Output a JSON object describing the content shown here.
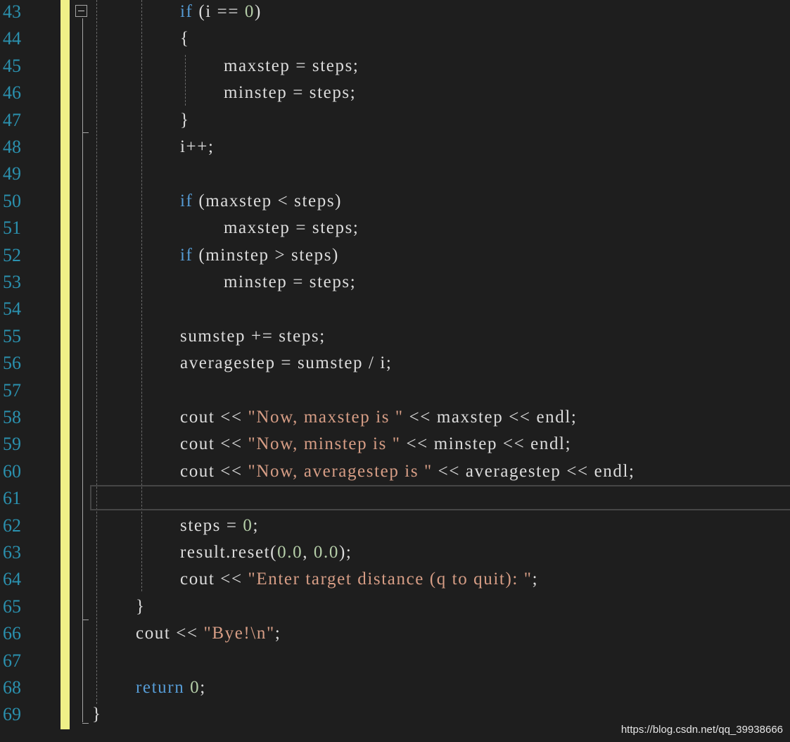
{
  "editor": {
    "lines": [
      {
        "num": "43",
        "indent": 4,
        "tokens": [
          {
            "t": "if",
            "c": "kw"
          },
          {
            "t": " (i == ",
            "c": "pl"
          },
          {
            "t": "0",
            "c": "num"
          },
          {
            "t": ")",
            "c": "pl"
          }
        ]
      },
      {
        "num": "44",
        "indent": 4,
        "tokens": [
          {
            "t": "{",
            "c": "pl"
          }
        ]
      },
      {
        "num": "45",
        "indent": 5,
        "tokens": [
          {
            "t": "maxstep = steps;",
            "c": "pl"
          }
        ]
      },
      {
        "num": "46",
        "indent": 5,
        "tokens": [
          {
            "t": "minstep = steps;",
            "c": "pl"
          }
        ]
      },
      {
        "num": "47",
        "indent": 4,
        "tokens": [
          {
            "t": "}",
            "c": "pl"
          }
        ]
      },
      {
        "num": "48",
        "indent": 4,
        "tokens": [
          {
            "t": "i++;",
            "c": "pl"
          }
        ]
      },
      {
        "num": "49",
        "indent": 4,
        "tokens": []
      },
      {
        "num": "50",
        "indent": 4,
        "tokens": [
          {
            "t": "if",
            "c": "kw"
          },
          {
            "t": " (maxstep < steps)",
            "c": "pl"
          }
        ]
      },
      {
        "num": "51",
        "indent": 5,
        "tokens": [
          {
            "t": "maxstep = steps;",
            "c": "pl"
          }
        ]
      },
      {
        "num": "52",
        "indent": 4,
        "tokens": [
          {
            "t": "if",
            "c": "kw"
          },
          {
            "t": " (minstep > steps)",
            "c": "pl"
          }
        ]
      },
      {
        "num": "53",
        "indent": 5,
        "tokens": [
          {
            "t": "minstep = steps;",
            "c": "pl"
          }
        ]
      },
      {
        "num": "54",
        "indent": 4,
        "tokens": []
      },
      {
        "num": "55",
        "indent": 4,
        "tokens": [
          {
            "t": "sumstep += steps;",
            "c": "pl"
          }
        ]
      },
      {
        "num": "56",
        "indent": 4,
        "tokens": [
          {
            "t": "averagestep = sumstep / i;",
            "c": "pl"
          }
        ]
      },
      {
        "num": "57",
        "indent": 4,
        "tokens": []
      },
      {
        "num": "58",
        "indent": 4,
        "tokens": [
          {
            "t": "cout << ",
            "c": "pl"
          },
          {
            "t": "\"Now, maxstep is \"",
            "c": "str"
          },
          {
            "t": " << maxstep << endl;",
            "c": "pl"
          }
        ]
      },
      {
        "num": "59",
        "indent": 4,
        "tokens": [
          {
            "t": "cout << ",
            "c": "pl"
          },
          {
            "t": "\"Now, minstep is \"",
            "c": "str"
          },
          {
            "t": " << minstep << endl;",
            "c": "pl"
          }
        ]
      },
      {
        "num": "60",
        "indent": 4,
        "tokens": [
          {
            "t": "cout << ",
            "c": "pl"
          },
          {
            "t": "\"Now, averagestep is \"",
            "c": "str"
          },
          {
            "t": " << averagestep << endl;",
            "c": "pl"
          }
        ]
      },
      {
        "num": "61",
        "indent": 4,
        "tokens": []
      },
      {
        "num": "62",
        "indent": 4,
        "tokens": [
          {
            "t": "steps = ",
            "c": "pl"
          },
          {
            "t": "0",
            "c": "num"
          },
          {
            "t": ";",
            "c": "pl"
          }
        ]
      },
      {
        "num": "63",
        "indent": 4,
        "tokens": [
          {
            "t": "result.reset(",
            "c": "pl"
          },
          {
            "t": "0.0",
            "c": "num"
          },
          {
            "t": ", ",
            "c": "pl"
          },
          {
            "t": "0.0",
            "c": "num"
          },
          {
            "t": ");",
            "c": "pl"
          }
        ]
      },
      {
        "num": "64",
        "indent": 4,
        "tokens": [
          {
            "t": "cout << ",
            "c": "pl"
          },
          {
            "t": "\"Enter target distance (q to quit): \"",
            "c": "str"
          },
          {
            "t": ";",
            "c": "pl"
          }
        ]
      },
      {
        "num": "65",
        "indent": 3,
        "tokens": [
          {
            "t": "}",
            "c": "pl"
          }
        ]
      },
      {
        "num": "66",
        "indent": 3,
        "tokens": [
          {
            "t": "cout << ",
            "c": "pl"
          },
          {
            "t": "\"Bye!\\n\"",
            "c": "str"
          },
          {
            "t": ";",
            "c": "pl"
          }
        ]
      },
      {
        "num": "67",
        "indent": 3,
        "tokens": []
      },
      {
        "num": "68",
        "indent": 3,
        "tokens": [
          {
            "t": "return",
            "c": "kw"
          },
          {
            "t": " ",
            "c": "pl"
          },
          {
            "t": "0",
            "c": "num"
          },
          {
            "t": ";",
            "c": "pl"
          }
        ]
      },
      {
        "num": "69",
        "indent": 2,
        "tokens": [
          {
            "t": "}",
            "c": "pl"
          }
        ]
      }
    ],
    "current_line": "61"
  },
  "colors": {
    "background": "#1e1e1e",
    "line_number": "#2b91af",
    "keyword": "#569cd6",
    "number": "#b5cea8",
    "string": "#d69d85",
    "text": "#dcdcdc",
    "change_bar": "#eff088"
  },
  "icons": {
    "fold": "collapse-minus-icon"
  },
  "watermark": "https://blog.csdn.net/qq_39938666"
}
